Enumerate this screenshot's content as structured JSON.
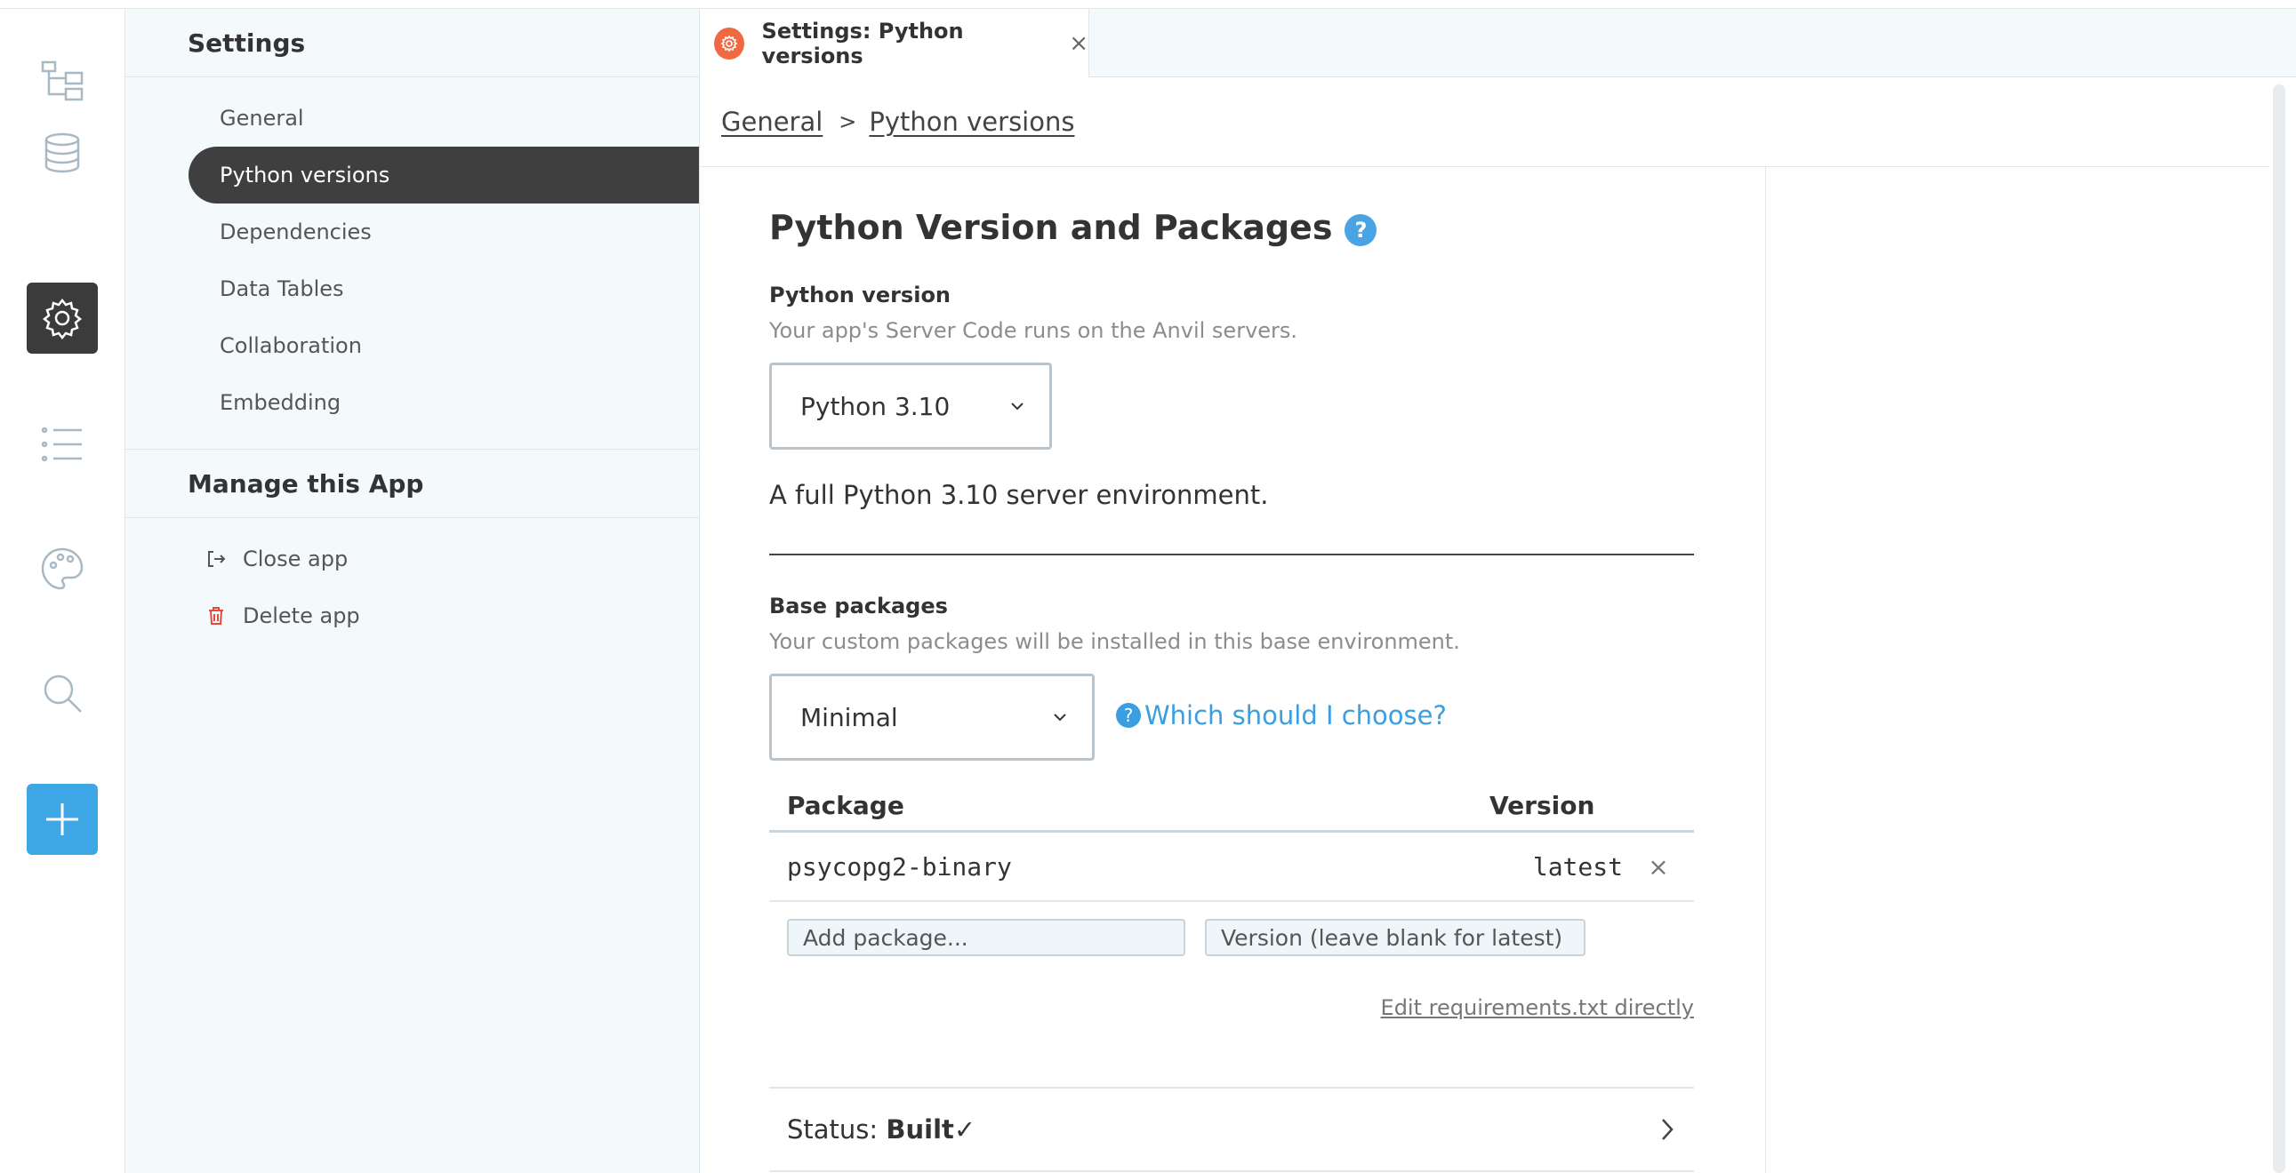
{
  "rail": {
    "items": [
      {
        "name": "app-tree-icon"
      },
      {
        "name": "database-icon"
      },
      {
        "name": "gear-icon",
        "active": true
      },
      {
        "name": "list-icon"
      },
      {
        "name": "palette-icon"
      },
      {
        "name": "search-icon"
      },
      {
        "name": "plus-icon"
      }
    ],
    "accent": "#3fa6e6"
  },
  "sidebar": {
    "title": "Settings",
    "items": [
      {
        "label": "General"
      },
      {
        "label": "Python versions",
        "active": true
      },
      {
        "label": "Dependencies"
      },
      {
        "label": "Data Tables"
      },
      {
        "label": "Collaboration"
      },
      {
        "label": "Embedding"
      }
    ],
    "manage_title": "Manage this App",
    "manage_items": [
      {
        "label": "Close app",
        "icon": "exit-icon"
      },
      {
        "label": "Delete app",
        "icon": "trash-icon",
        "icon_color": "#e34c3c"
      }
    ]
  },
  "tab": {
    "label": "Settings: Python versions",
    "close": "×",
    "icon_color": "#ef6a43"
  },
  "breadcrumb": {
    "root": "General",
    "separator": ">",
    "current": "Python versions"
  },
  "main": {
    "title": "Python Version and Packages",
    "help": "?",
    "python_version": {
      "label": "Python version",
      "hint": "Your app's Server Code runs on the Anvil servers.",
      "selected": "Python 3.10",
      "description": "A full Python 3.10 server environment."
    },
    "base_packages": {
      "label": "Base packages",
      "hint": "Your custom packages will be installed in this base environment.",
      "selected": "Minimal",
      "help_link": "Which should I choose?",
      "help_icon": "?"
    },
    "packages_table": {
      "columns": [
        "Package",
        "Version"
      ],
      "rows": [
        {
          "package": "psycopg2-binary",
          "version": "latest",
          "remove": "×"
        }
      ],
      "add_package_placeholder": "Add package...",
      "add_version_placeholder": "Version (leave blank for latest)"
    },
    "edit_requirements": "Edit requirements.txt directly",
    "status": {
      "prefix": "Status:",
      "value": "Built",
      "check": "✓"
    }
  }
}
